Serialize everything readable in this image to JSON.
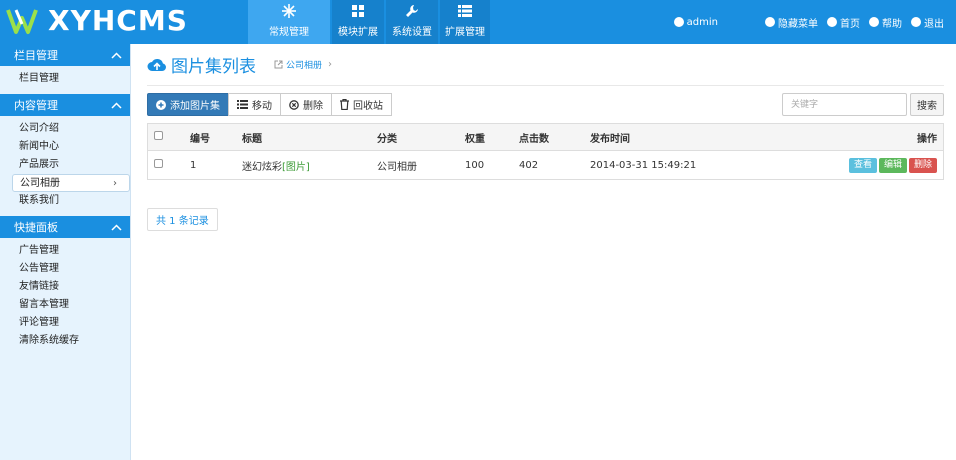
{
  "header": {
    "logo_text": "XYHCMS",
    "nav": [
      {
        "label": "常规管理",
        "icon": "snowflake-icon",
        "active": true
      },
      {
        "label": "模块扩展",
        "icon": "grid-icon",
        "active": false
      },
      {
        "label": "系统设置",
        "icon": "wrench-icon",
        "active": false
      },
      {
        "label": "扩展管理",
        "icon": "list-icon",
        "active": false
      }
    ],
    "user": "admin",
    "links": [
      {
        "label": "隐藏菜单",
        "icon": "menu-circle-icon"
      },
      {
        "label": "首页",
        "icon": "home-icon"
      },
      {
        "label": "帮助",
        "icon": "help-icon"
      },
      {
        "label": "退出",
        "icon": "logout-icon"
      }
    ]
  },
  "sidebar": {
    "groups": [
      {
        "title": "栏目管理",
        "items": [
          "栏目管理"
        ]
      },
      {
        "title": "内容管理",
        "items": [
          "公司介绍",
          "新闻中心",
          "产品展示",
          "公司相册",
          "联系我们"
        ],
        "active_item": "公司相册"
      },
      {
        "title": "快捷面板",
        "items": [
          "广告管理",
          "公告管理",
          "友情链接",
          "留言本管理",
          "评论管理",
          "清除系统缓存"
        ]
      }
    ]
  },
  "main": {
    "title": "图片集列表",
    "breadcrumb": "公司相册",
    "toolbar": {
      "add": "添加图片集",
      "move": "移动",
      "delete": "删除",
      "recycle": "回收站"
    },
    "search": {
      "placeholder": "关键字",
      "button": "搜索"
    },
    "table": {
      "headers": {
        "id": "编号",
        "title": "标题",
        "category": "分类",
        "weight": "权重",
        "clicks": "点击数",
        "time": "发布时间",
        "ops": "操作"
      },
      "rows": [
        {
          "id": "1",
          "title": "迷幻炫彩",
          "tag": "[图片]",
          "category": "公司相册",
          "weight": "100",
          "clicks": "402",
          "time": "2014-03-31 15:49:21"
        }
      ],
      "ops": {
        "view": "查看",
        "edit": "编辑",
        "delete": "删除"
      }
    },
    "pager": "共 1 条记录"
  },
  "colors": {
    "brand": "#1a8fe0",
    "primary_button": "#337ab7",
    "view": "#5bc0de",
    "edit": "#5cb85c",
    "delete": "#d9534f"
  }
}
